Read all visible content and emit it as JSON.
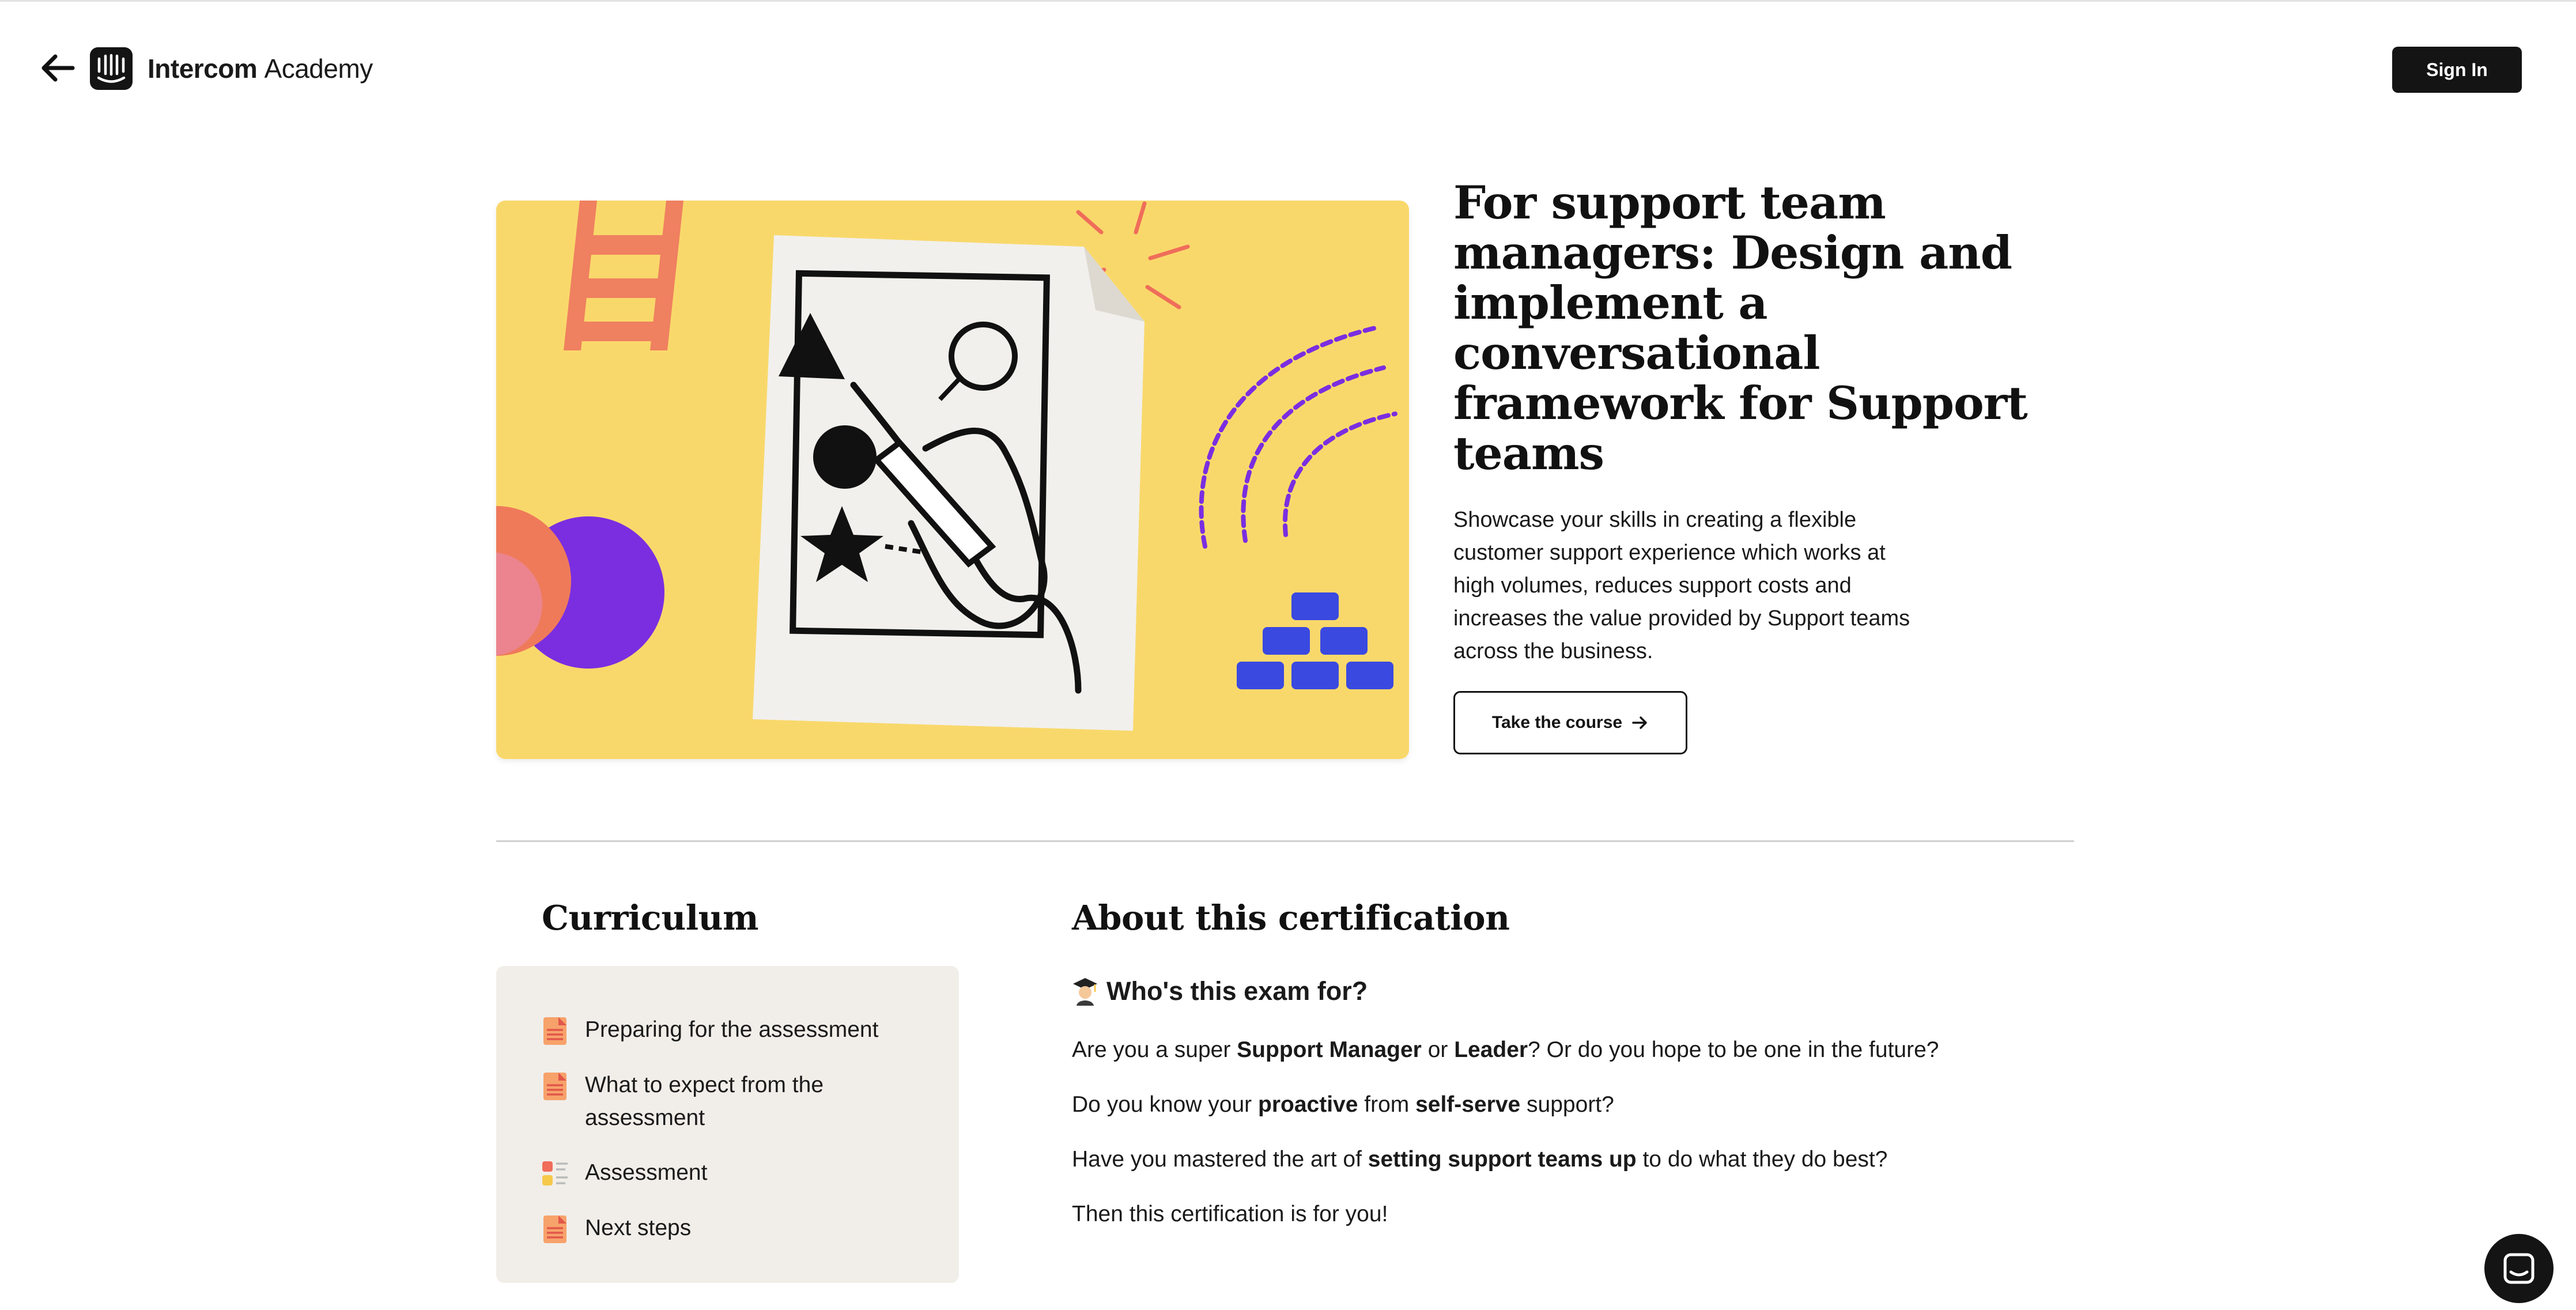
{
  "header": {
    "brand_name": "Intercom",
    "brand_suffix": "Academy",
    "signin_label": "Sign In",
    "icons": {
      "back": "arrow-left-icon",
      "logo": "intercom-logo-icon"
    }
  },
  "hero": {
    "title": "For support team managers: Design and implement a conversational framework for Support teams",
    "description": "Showcase your skills in creating a flexible customer support experience which works at high volumes, reduces support costs and increases the value provided by Support teams across the business.",
    "cta_label": "Take the course",
    "image_bg": "#f9d86b"
  },
  "curriculum": {
    "title": "Curriculum",
    "items": [
      {
        "label": "Preparing for the assessment",
        "icon": "document-icon"
      },
      {
        "label": "What to expect from the assessment",
        "icon": "document-icon"
      },
      {
        "label": "Assessment",
        "icon": "checklist-icon"
      },
      {
        "label": "Next steps",
        "icon": "document-icon"
      }
    ]
  },
  "about": {
    "title": "About this certification",
    "subtitle": "Who's this exam for?",
    "p1": {
      "a": "Are you a super ",
      "b1": "Support Manager",
      "c": " or ",
      "b2": "Leader",
      "d": "? Or do you hope to be one in the future?"
    },
    "p2": {
      "a": "Do you know your ",
      "b1": "proactive",
      "c": " from ",
      "b2": "self-serve",
      "d": " support?"
    },
    "p3": {
      "a": "Have you mastered the art of ",
      "b1": "setting support teams up",
      "c": " to do what they do best?"
    },
    "p4": "Then this certification is for you!"
  },
  "colors": {
    "accent_dark": "#141414",
    "curriculum_bg": "#f1eee9",
    "purple": "#7a2ee0",
    "blue": "#3a49e0",
    "coral": "#ef8060"
  }
}
